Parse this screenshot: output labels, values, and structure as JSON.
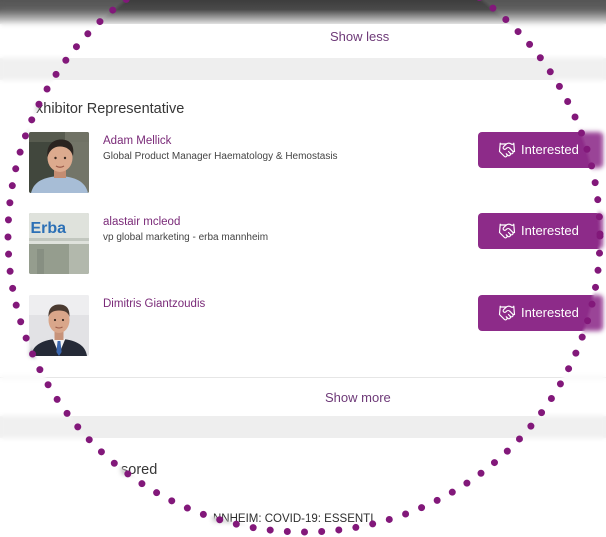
{
  "top_section": {
    "show_less_label": "Show less"
  },
  "exhibitor_section": {
    "heading": "xhibitor Representative",
    "representatives": [
      {
        "name": "Adam Mellick",
        "title": "Global Product Manager Haematology & Hemostasis",
        "button_label": "Interested",
        "button_icon": "handshake-icon"
      },
      {
        "name": "alastair mcleod",
        "title": "vp global marketing - erba mannheim",
        "photo_logo_text": "Erba",
        "button_label": "Interested",
        "button_icon": "handshake-icon"
      },
      {
        "name": "Dimitris Giantzoudis",
        "button_label": "Interested",
        "button_icon": "handshake-icon"
      }
    ],
    "show_more_label": "Show more"
  },
  "sponsored_section": {
    "heading": "sored",
    "item_title": "NNHEIM: COVID-19: ESSENTI"
  },
  "colors": {
    "accent": "#8d2b89",
    "name_link": "#7a2a78",
    "link": "#6e3a78",
    "annotation_dots": "#82187a",
    "header_bar": "#3d3d3d"
  }
}
